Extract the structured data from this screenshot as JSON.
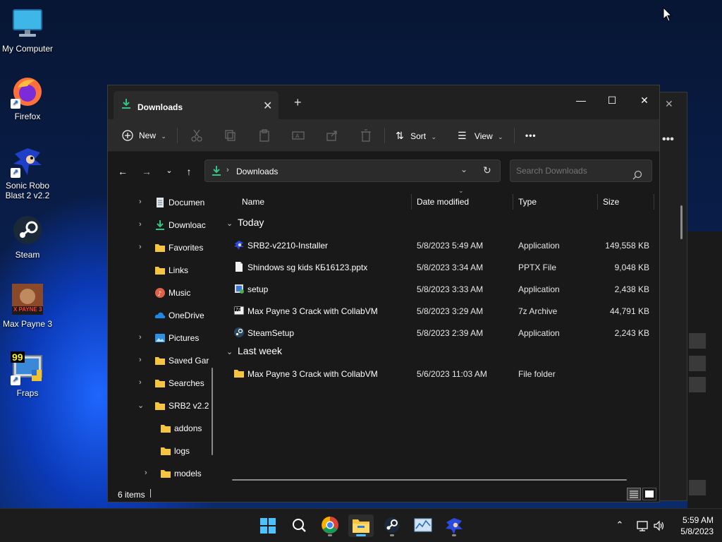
{
  "desktop": {
    "icons": [
      {
        "label": "My Computer"
      },
      {
        "label": "Firefox"
      },
      {
        "label": "Sonic Robo Blast 2 v2.2"
      },
      {
        "label": "Steam"
      },
      {
        "label": "Max Payne 3",
        "badge": "X PAYNE 3"
      },
      {
        "label": "Fraps",
        "badge": "99"
      }
    ]
  },
  "explorer": {
    "tab_title": "Downloads",
    "window_controls": {
      "minimize": "—",
      "maximize": "☐",
      "close": "✕"
    },
    "toolbar": {
      "new_label": "New",
      "sort_label": "Sort",
      "view_label": "View",
      "more_label": "•••"
    },
    "address": {
      "breadcrumb": "Downloads",
      "search_placeholder": "Search Downloads"
    },
    "nav_items": [
      {
        "label": "Documen",
        "icon": "document-icon",
        "expander": true
      },
      {
        "label": "Downloac",
        "icon": "download-icon",
        "expander": true
      },
      {
        "label": "Favorites",
        "icon": "folder-icon",
        "expander": true
      },
      {
        "label": "Links",
        "icon": "folder-icon",
        "expander": false
      },
      {
        "label": "Music",
        "icon": "music-icon",
        "expander": false
      },
      {
        "label": "OneDrive",
        "icon": "cloud-icon",
        "expander": false
      },
      {
        "label": "Pictures",
        "icon": "pictures-icon",
        "expander": true
      },
      {
        "label": "Saved Gar",
        "icon": "folder-icon",
        "expander": true
      },
      {
        "label": "Searches",
        "icon": "folder-icon",
        "expander": true
      },
      {
        "label": "SRB2 v2.2",
        "icon": "folder-icon",
        "expander": true,
        "expanded": true
      },
      {
        "label": "addons",
        "icon": "folder-icon",
        "expander": false
      },
      {
        "label": "logs",
        "icon": "folder-icon",
        "expander": false
      },
      {
        "label": "models",
        "icon": "folder-icon",
        "expander": true
      }
    ],
    "columns": {
      "name": "Name",
      "date": "Date modified",
      "type": "Type",
      "size": "Size"
    },
    "groups": [
      {
        "label": "Today",
        "files": [
          {
            "name": "SRB2-v2210-Installer",
            "date": "5/8/2023 5:49 AM",
            "type": "Application",
            "size": "149,558 KB",
            "icon": "sonic-app-icon"
          },
          {
            "name": "Shindows sg kids КБ16123.pptx",
            "date": "5/8/2023 3:34 AM",
            "type": "PPTX File",
            "size": "9,048 KB",
            "icon": "document-icon"
          },
          {
            "name": "setup",
            "date": "5/8/2023 3:33 AM",
            "type": "Application",
            "size": "2,438 KB",
            "icon": "setup-icon"
          },
          {
            "name": "Max Payne 3 Crack with CollabVM",
            "date": "5/8/2023 3:29 AM",
            "type": "7z Archive",
            "size": "44,791 KB",
            "icon": "archive-icon"
          },
          {
            "name": "SteamSetup",
            "date": "5/8/2023 2:39 AM",
            "type": "Application",
            "size": "2,243 KB",
            "icon": "steam-icon"
          }
        ]
      },
      {
        "label": "Last week",
        "files": [
          {
            "name": "Max Payne 3 Crack with CollabVM",
            "date": "5/6/2023 11:03 AM",
            "type": "File folder",
            "size": "",
            "icon": "folder-icon"
          }
        ]
      }
    ],
    "status": "6 items"
  },
  "taskbar": {
    "time": "5:59 AM",
    "date": "5/8/2023",
    "apps": [
      "start-icon",
      "search-icon",
      "chrome-icon",
      "file-explorer-icon",
      "steam-icon",
      "task-manager-icon",
      "sonic-icon"
    ]
  },
  "colors": {
    "accent": "#4cc2ff",
    "folder": "#f4c542",
    "download_green": "#33c481",
    "window_bg": "#191919",
    "toolbar_bg": "#2b2b2b"
  }
}
